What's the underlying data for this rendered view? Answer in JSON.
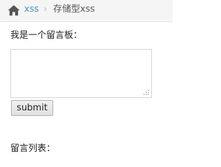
{
  "breadcrumb": {
    "home_icon": "home-icon",
    "link": "xss",
    "separator": "›",
    "current": "存储型xss",
    "link_color": "#4c8fbd"
  },
  "form": {
    "label": "我是一个留言板：",
    "textarea_value": "",
    "submit_label": "submit"
  },
  "list": {
    "label": "留言列表："
  }
}
